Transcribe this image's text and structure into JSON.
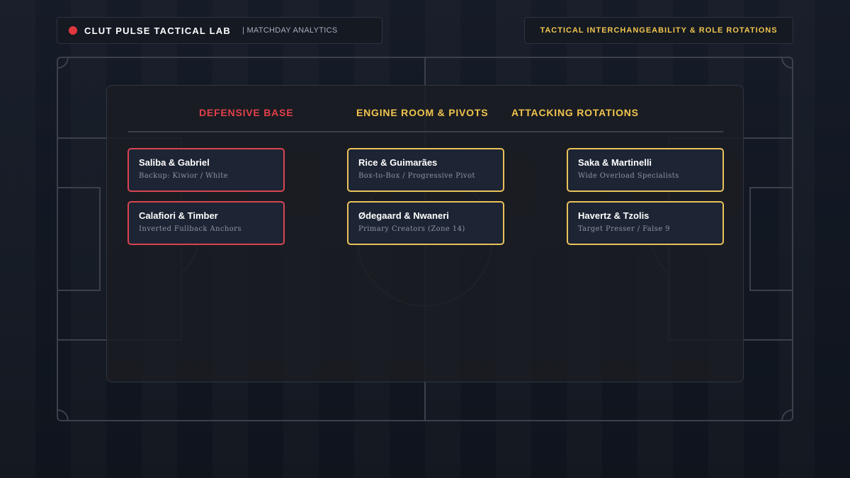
{
  "header": {
    "brand_title": "CLUT PULSE TACTICAL LAB",
    "brand_subtitle": "| MATCHDAY ANALYTICS",
    "section_title": "TACTICAL INTERCHANGEABILITY & ROLE ROTATIONS",
    "live_color": "#e0373f"
  },
  "columns": {
    "defensive": {
      "title": "DEFENSIVE BASE",
      "accent": "#e2404a",
      "cards": [
        {
          "name": "Saliba & Gabriel",
          "role": "Backup: Kiwior / White"
        },
        {
          "name": "Calafiori & Timber",
          "role": "Inverted Fullback Anchors"
        }
      ]
    },
    "midfield": {
      "title": "ENGINE ROOM & PIVOTS",
      "accent": "#f0c44e",
      "cards": [
        {
          "name": "Rice & Guimarães",
          "role": "Box-to-Box / Progressive Pivot"
        },
        {
          "name": "Ødegaard & Nwaneri",
          "role": "Primary Creators (Zone 14)"
        }
      ]
    },
    "attacking": {
      "title": "ATTACKING ROTATIONS",
      "accent": "#f0c44e",
      "cards": [
        {
          "name": "Saka & Martinelli",
          "role": "Wide Overload Specialists"
        },
        {
          "name": "Havertz & Tzolis",
          "role": "Target Presser / False 9"
        }
      ]
    }
  }
}
